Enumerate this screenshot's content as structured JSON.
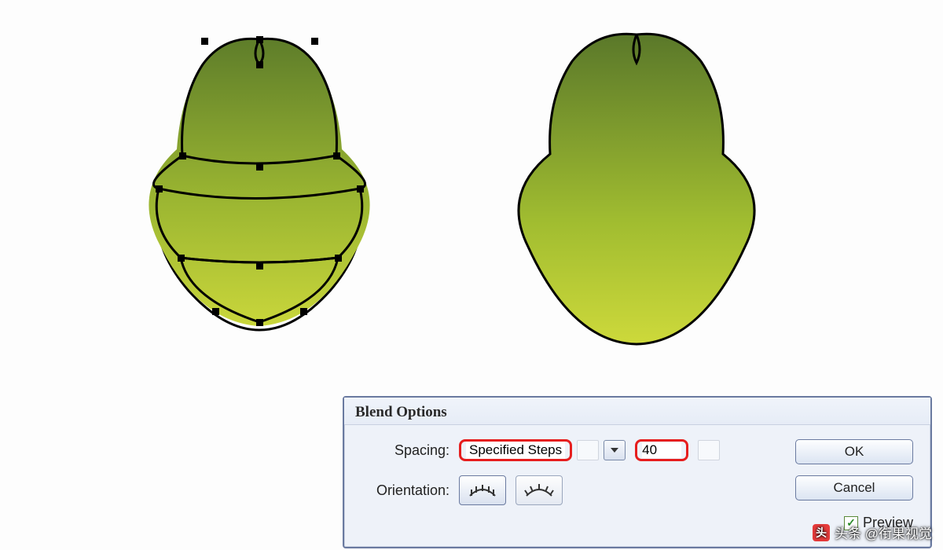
{
  "dialog": {
    "title": "Blend Options",
    "spacing_label": "Spacing:",
    "spacing_mode": "Specified Steps",
    "spacing_value": "40",
    "orientation_label": "Orientation:",
    "ok_label": "OK",
    "cancel_label": "Cancel",
    "preview_label": "Preview",
    "preview_checked": true
  },
  "watermark": {
    "text": "头条 @衔果视觉"
  },
  "shapes": {
    "left_description": "selected blend steps with anchor points",
    "right_description": "smooth blended result",
    "colors": {
      "outline": "#000000",
      "fill_top": "#6b8a2f",
      "fill_mid": "#9ab531",
      "fill_bottom": "#c9d63b"
    }
  }
}
